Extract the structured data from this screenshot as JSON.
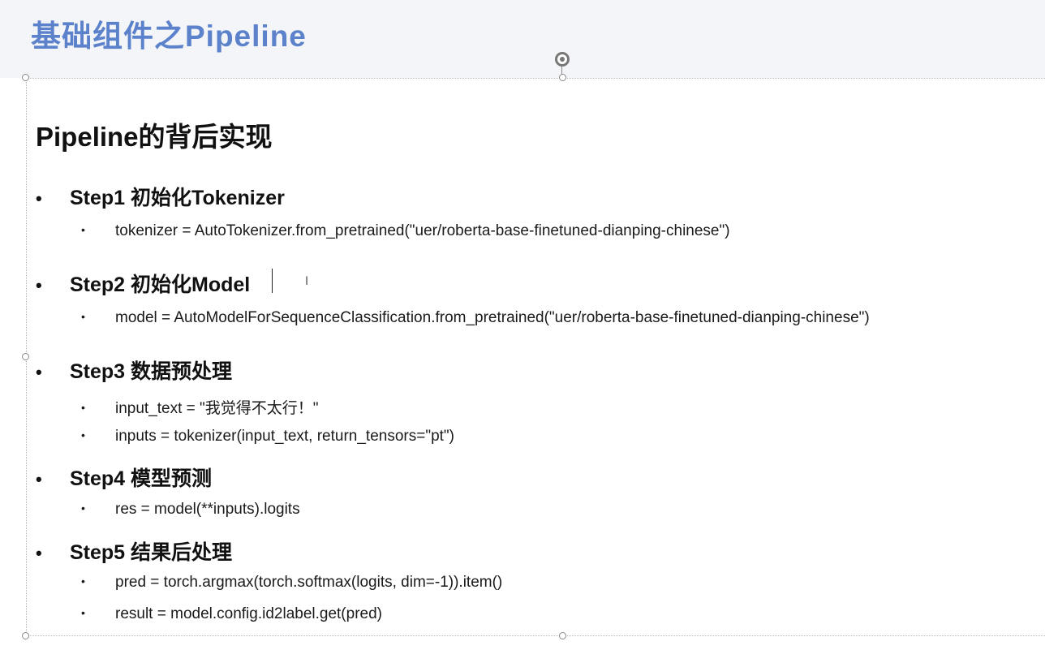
{
  "slide": {
    "title": "基础组件之Pipeline"
  },
  "content": {
    "heading": "Pipeline的背后实现",
    "bullet_main": "•",
    "bullet_sub": "•",
    "steps": [
      {
        "label": "Step1 初始化Tokenizer",
        "lines": [
          "tokenizer = AutoTokenizer.from_pretrained(\"uer/roberta-base-finetuned-dianping-chinese\")"
        ]
      },
      {
        "label": "Step2 初始化Model",
        "lines": [
          "model = AutoModelForSequenceClassification.from_pretrained(\"uer/roberta-base-finetuned-dianping-chinese\")"
        ]
      },
      {
        "label": "Step3 数据预处理",
        "lines": [
          "input_text = \"我觉得不太行！\"",
          "inputs = tokenizer(input_text, return_tensors=\"pt\")"
        ]
      },
      {
        "label": "Step4 模型预测",
        "lines": [
          "res = model(**inputs).logits"
        ]
      },
      {
        "label": "Step5 结果后处理",
        "lines": [
          "pred = torch.argmax(torch.softmax(logits, dim=-1)).item()",
          "result = model.config.id2label.get(pred)"
        ]
      }
    ]
  },
  "icons": {
    "rotate": "rotate-handle-icon",
    "cursor": "ibeam-cursor-icon"
  }
}
